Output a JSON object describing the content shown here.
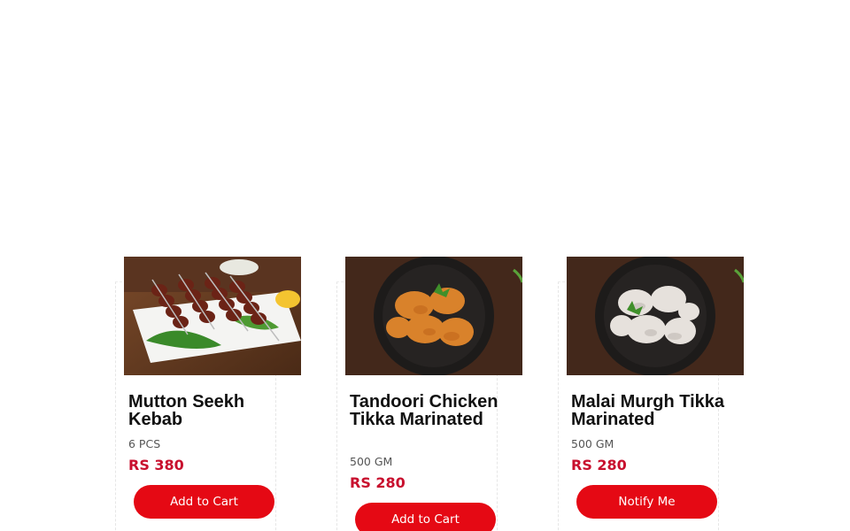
{
  "products": [
    {
      "name": "Mutton Seekh Kebab",
      "quantity": "6 PCS",
      "price": "RS 380",
      "action_label": "Add to Cart",
      "image_desc_icon": "seekh-kebab-plate"
    },
    {
      "name": "Tandoori Chicken Tikka Marinated",
      "quantity": "500 GM",
      "price": "RS 280",
      "action_label": "Add to Cart",
      "image_desc_icon": "chicken-tikka-bowl"
    },
    {
      "name": "Malai Murgh Tikka Marinated",
      "quantity": "500 GM",
      "price": "RS 280",
      "action_label": "Notify Me",
      "image_desc_icon": "malai-tikka-bowl"
    }
  ],
  "colors": {
    "accent": "#e50914",
    "price": "#c8102e",
    "text": "#111111"
  }
}
